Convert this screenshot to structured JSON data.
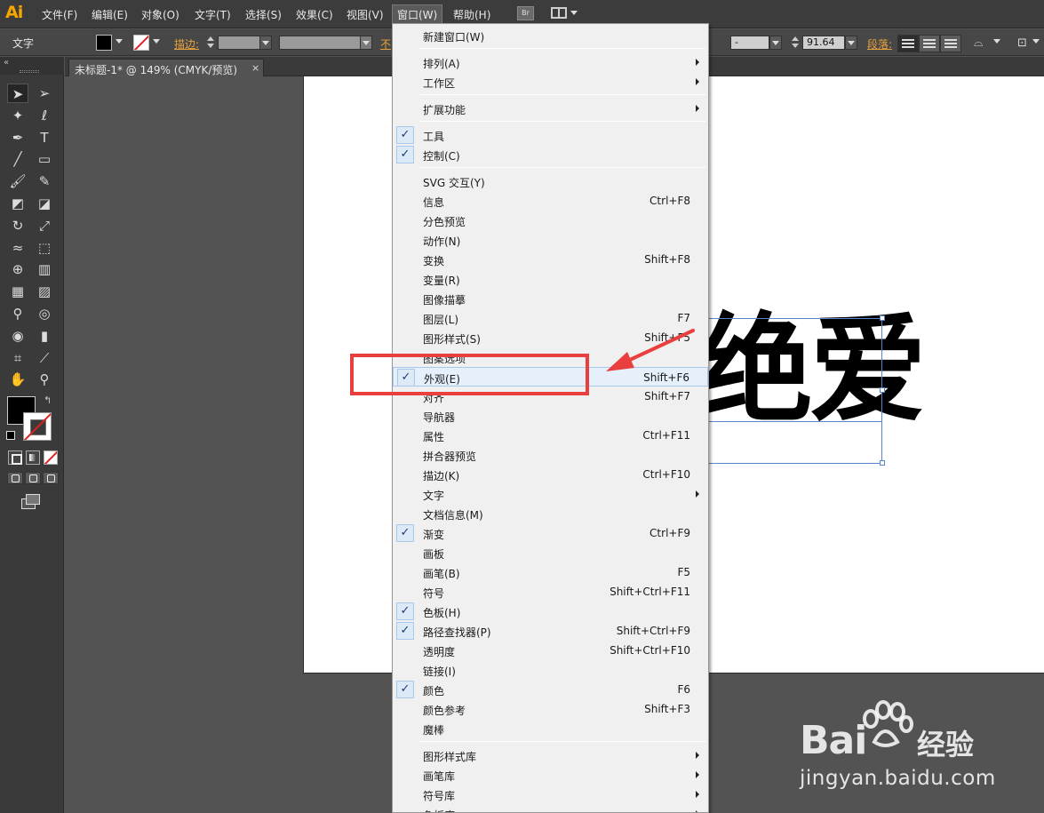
{
  "app": {
    "logo": "Ai"
  },
  "menubar": {
    "items": [
      {
        "label": "文件(F)"
      },
      {
        "label": "编辑(E)"
      },
      {
        "label": "对象(O)"
      },
      {
        "label": "文字(T)"
      },
      {
        "label": "选择(S)"
      },
      {
        "label": "效果(C)"
      },
      {
        "label": "视图(V)"
      },
      {
        "label": "窗口(W)"
      },
      {
        "label": "帮助(H)"
      }
    ],
    "active_index": 7,
    "bridge_label": "Br"
  },
  "controlbar": {
    "tool_name": "文字",
    "stroke_label": "描边:",
    "opacity_label_partial": "不",
    "font_size_value": "-",
    "tracking_value": "91.64",
    "paragraph_label": "段落:"
  },
  "document": {
    "tab_label": "未标题-1* @ 149% (CMYK/预览)",
    "close_glyph": "×",
    "art_text": "绝爱"
  },
  "window_menu": {
    "items": [
      {
        "label": "新建窗口(W)",
        "shortcut": "",
        "submenu": false,
        "checked": false
      },
      {
        "sep": true
      },
      {
        "label": "排列(A)",
        "shortcut": "",
        "submenu": true,
        "checked": false
      },
      {
        "label": "工作区",
        "shortcut": "",
        "submenu": true,
        "checked": false
      },
      {
        "sep": true
      },
      {
        "label": "扩展功能",
        "shortcut": "",
        "submenu": true,
        "checked": false
      },
      {
        "sep": true
      },
      {
        "label": "工具",
        "shortcut": "",
        "submenu": false,
        "checked": true
      },
      {
        "label": "控制(C)",
        "shortcut": "",
        "submenu": false,
        "checked": true
      },
      {
        "sep": true
      },
      {
        "label": "SVG 交互(Y)",
        "shortcut": "",
        "submenu": false,
        "checked": false
      },
      {
        "label": "信息",
        "shortcut": "Ctrl+F8",
        "submenu": false,
        "checked": false
      },
      {
        "label": "分色预览",
        "shortcut": "",
        "submenu": false,
        "checked": false
      },
      {
        "label": "动作(N)",
        "shortcut": "",
        "submenu": false,
        "checked": false
      },
      {
        "label": "变换",
        "shortcut": "Shift+F8",
        "submenu": false,
        "checked": false
      },
      {
        "label": "变量(R)",
        "shortcut": "",
        "submenu": false,
        "checked": false
      },
      {
        "label": "图像描摹",
        "shortcut": "",
        "submenu": false,
        "checked": false
      },
      {
        "label": "图层(L)",
        "shortcut": "F7",
        "submenu": false,
        "checked": false
      },
      {
        "label": "图形样式(S)",
        "shortcut": "Shift+F5",
        "submenu": false,
        "checked": false
      },
      {
        "label": "图案选项",
        "shortcut": "",
        "submenu": false,
        "checked": false
      },
      {
        "label": "外观(E)",
        "shortcut": "Shift+F6",
        "submenu": false,
        "checked": true,
        "highlighted": true
      },
      {
        "label": "对齐",
        "shortcut": "Shift+F7",
        "submenu": false,
        "checked": false
      },
      {
        "label": "导航器",
        "shortcut": "",
        "submenu": false,
        "checked": false
      },
      {
        "label": "属性",
        "shortcut": "Ctrl+F11",
        "submenu": false,
        "checked": false
      },
      {
        "label": "拼合器预览",
        "shortcut": "",
        "submenu": false,
        "checked": false
      },
      {
        "label": "描边(K)",
        "shortcut": "Ctrl+F10",
        "submenu": false,
        "checked": false
      },
      {
        "label": "文字",
        "shortcut": "",
        "submenu": true,
        "checked": false
      },
      {
        "label": "文档信息(M)",
        "shortcut": "",
        "submenu": false,
        "checked": false
      },
      {
        "label": "渐变",
        "shortcut": "Ctrl+F9",
        "submenu": false,
        "checked": true
      },
      {
        "label": "画板",
        "shortcut": "",
        "submenu": false,
        "checked": false
      },
      {
        "label": "画笔(B)",
        "shortcut": "F5",
        "submenu": false,
        "checked": false
      },
      {
        "label": "符号",
        "shortcut": "Shift+Ctrl+F11",
        "submenu": false,
        "checked": false
      },
      {
        "label": "色板(H)",
        "shortcut": "",
        "submenu": false,
        "checked": true
      },
      {
        "label": "路径查找器(P)",
        "shortcut": "Shift+Ctrl+F9",
        "submenu": false,
        "checked": true
      },
      {
        "label": "透明度",
        "shortcut": "Shift+Ctrl+F10",
        "submenu": false,
        "checked": false
      },
      {
        "label": "链接(I)",
        "shortcut": "",
        "submenu": false,
        "checked": false
      },
      {
        "label": "颜色",
        "shortcut": "F6",
        "submenu": false,
        "checked": true
      },
      {
        "label": "颜色参考",
        "shortcut": "Shift+F3",
        "submenu": false,
        "checked": false
      },
      {
        "label": "魔棒",
        "shortcut": "",
        "submenu": false,
        "checked": false
      },
      {
        "sep": true
      },
      {
        "label": "图形样式库",
        "shortcut": "",
        "submenu": true,
        "checked": false
      },
      {
        "label": "画笔库",
        "shortcut": "",
        "submenu": true,
        "checked": false
      },
      {
        "label": "符号库",
        "shortcut": "",
        "submenu": true,
        "checked": false
      },
      {
        "label": "色板库",
        "shortcut": "",
        "submenu": true,
        "checked": false
      }
    ]
  },
  "tools": [
    {
      "name": "selection-tool-icon",
      "glyph": "➤",
      "selected": true
    },
    {
      "name": "direct-selection-tool-icon",
      "glyph": "➢"
    },
    {
      "name": "magic-wand-tool-icon",
      "glyph": "✦"
    },
    {
      "name": "lasso-tool-icon",
      "glyph": "ℓ"
    },
    {
      "name": "pen-tool-icon",
      "glyph": "✒"
    },
    {
      "name": "type-tool-icon",
      "glyph": "T"
    },
    {
      "name": "line-tool-icon",
      "glyph": "╱"
    },
    {
      "name": "rectangle-tool-icon",
      "glyph": "▭"
    },
    {
      "name": "paintbrush-tool-icon",
      "glyph": "🖌"
    },
    {
      "name": "pencil-tool-icon",
      "glyph": "✎"
    },
    {
      "name": "blob-brush-tool-icon",
      "glyph": "◩"
    },
    {
      "name": "eraser-tool-icon",
      "glyph": "◪"
    },
    {
      "name": "rotate-tool-icon",
      "glyph": "↻"
    },
    {
      "name": "scale-tool-icon",
      "glyph": "⤢"
    },
    {
      "name": "warp-tool-icon",
      "glyph": "≈"
    },
    {
      "name": "free-transform-tool-icon",
      "glyph": "⬚"
    },
    {
      "name": "shape-builder-tool-icon",
      "glyph": "⊕"
    },
    {
      "name": "perspective-grid-tool-icon",
      "glyph": "▥"
    },
    {
      "name": "mesh-tool-icon",
      "glyph": "▦"
    },
    {
      "name": "gradient-tool-icon",
      "glyph": "▨"
    },
    {
      "name": "eyedropper-tool-icon",
      "glyph": "⚲"
    },
    {
      "name": "blend-tool-icon",
      "glyph": "◎"
    },
    {
      "name": "symbol-sprayer-tool-icon",
      "glyph": "◉"
    },
    {
      "name": "column-graph-tool-icon",
      "glyph": "▮"
    },
    {
      "name": "artboard-tool-icon",
      "glyph": "⌗"
    },
    {
      "name": "slice-tool-icon",
      "glyph": "⟋"
    },
    {
      "name": "hand-tool-icon",
      "glyph": "✋"
    },
    {
      "name": "zoom-tool-icon",
      "glyph": "⚲"
    }
  ],
  "watermark": {
    "brand_left": "Bai",
    "brand_right": "经验",
    "url": "jingyan.baidu.com"
  },
  "colors": {
    "highlight_red": "#ea3f3f",
    "ai_orange": "#f7a600",
    "selection_blue": "#5b84c8"
  }
}
